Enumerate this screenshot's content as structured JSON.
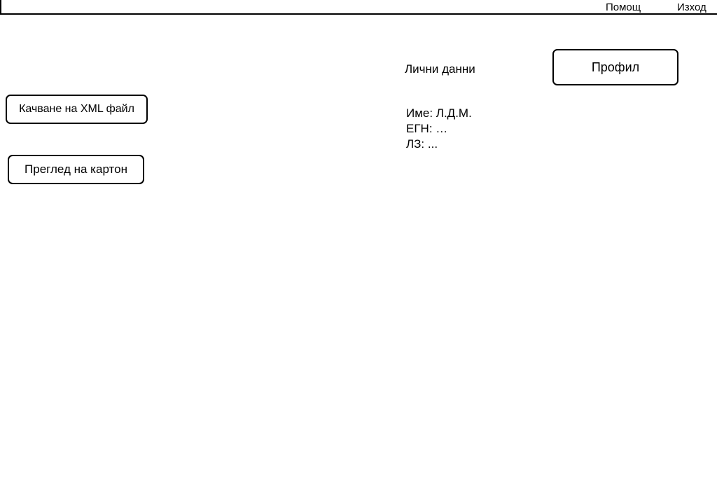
{
  "header": {
    "help_label": "Помощ",
    "logout_label": "Изход"
  },
  "actions": {
    "upload_xml_label": "Качване на XML файл",
    "view_record_label": "Преглед на картон"
  },
  "profile": {
    "button_label": "Профил",
    "section_title": "Лични данни",
    "fields": [
      {
        "text": "Име: Л.Д.М."
      },
      {
        "text": "ЕГН: …"
      },
      {
        "text": "ЛЗ: ..."
      }
    ]
  }
}
